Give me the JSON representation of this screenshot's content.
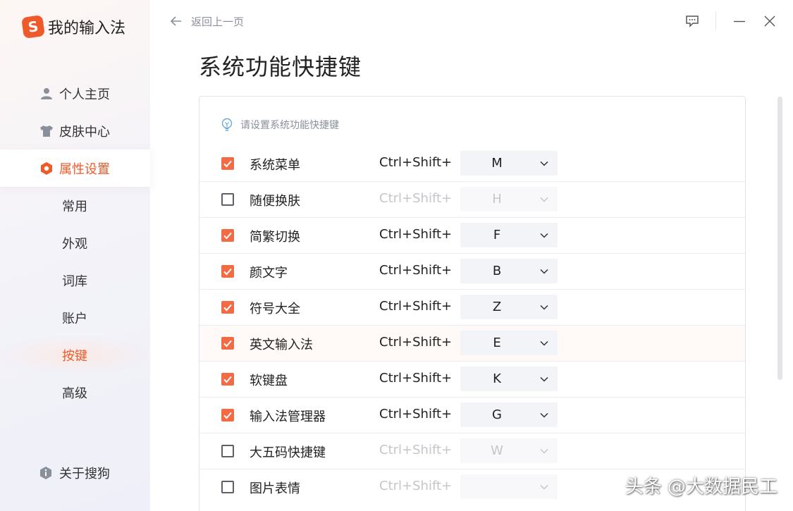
{
  "colors": {
    "accent": "#ef5a2a",
    "checkbox_checked": "#f26b45",
    "muted": "#8a8f9c",
    "disabled": "#c4c6cc"
  },
  "sidebar": {
    "logo_mark": "S",
    "logo_text": "我的输入法",
    "nav": [
      {
        "label": "个人主页",
        "icon": "user-icon"
      },
      {
        "label": "皮肤中心",
        "icon": "tshirt-icon"
      },
      {
        "label": "属性设置",
        "icon": "hexagon-settings-icon",
        "active": true
      }
    ],
    "sub_items": [
      {
        "label": "常用"
      },
      {
        "label": "外观"
      },
      {
        "label": "词库"
      },
      {
        "label": "账户"
      },
      {
        "label": "按键",
        "active": true
      },
      {
        "label": "高级"
      }
    ],
    "about": {
      "label": "关于搜狗",
      "icon": "info-shield-icon"
    }
  },
  "header": {
    "back_label": "返回上一页",
    "icons": [
      "back-arrow-icon",
      "feedback-icon",
      "minimize-icon",
      "close-icon"
    ]
  },
  "page_title": "系统功能快捷键",
  "hint": {
    "text": "请设置系统功能快捷键",
    "icon": "lightbulb-icon"
  },
  "shortcuts": [
    {
      "name": "系统菜单",
      "checked": true,
      "modifier": "Ctrl+Shift+",
      "key": "M"
    },
    {
      "name": "随便换肤",
      "checked": false,
      "modifier": "Ctrl+Shift+",
      "key": "H"
    },
    {
      "name": "简繁切换",
      "checked": true,
      "modifier": "Ctrl+Shift+",
      "key": "F"
    },
    {
      "name": "颜文字",
      "checked": true,
      "modifier": "Ctrl+Shift+",
      "key": "B"
    },
    {
      "name": "符号大全",
      "checked": true,
      "modifier": "Ctrl+Shift+",
      "key": "Z"
    },
    {
      "name": "英文输入法",
      "checked": true,
      "modifier": "Ctrl+Shift+",
      "key": "E",
      "highlighted": true
    },
    {
      "name": "软键盘",
      "checked": true,
      "modifier": "Ctrl+Shift+",
      "key": "K"
    },
    {
      "name": "输入法管理器",
      "checked": true,
      "modifier": "Ctrl+Shift+",
      "key": "G"
    },
    {
      "name": "大五码快捷键",
      "checked": false,
      "modifier": "Ctrl+Shift+",
      "key": "W"
    },
    {
      "name": "图片表情",
      "checked": false,
      "modifier": "Ctrl+Shift+",
      "key": ""
    }
  ],
  "watermark": "头条 @大数据民工"
}
